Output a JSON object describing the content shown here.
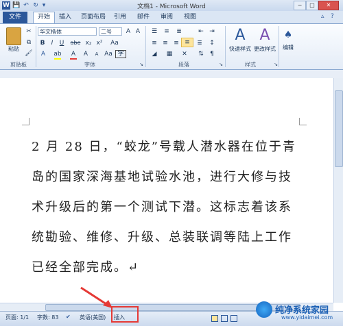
{
  "window": {
    "title": "文档1 - Microsoft Word",
    "controls": [
      "−",
      "□",
      "✕"
    ]
  },
  "quick_access": [
    "W",
    "💾",
    "↶",
    "↻",
    "▾"
  ],
  "ribbon": {
    "tabs": [
      "文件",
      "开始",
      "插入",
      "页面布局",
      "引用",
      "邮件",
      "审阅",
      "视图"
    ],
    "active_tab": "开始",
    "clipboard": {
      "label": "剪贴板",
      "paste": "粘贴"
    },
    "font": {
      "label": "字体",
      "family": "华文楷体",
      "size": "二号",
      "buttons": [
        "B",
        "I",
        "U",
        "abe",
        "x₂",
        "x²",
        "A",
        "A",
        "Aa",
        "A",
        "A"
      ]
    },
    "paragraph": {
      "label": "段落"
    },
    "styles": {
      "label": "样式",
      "quick_styles": "快速样式",
      "change_styles": "更改样式"
    },
    "editing": {
      "label": "编辑"
    }
  },
  "document": {
    "lines": [
      "2 月 28 日，“蛟龙”号载人潜水器在位于青",
      "岛的国家深海基地试验水池，进行大修与技",
      "术升级后的第一个测试下潜。这标志着该系",
      "统勘验、维修、升级、总装联调等陆上工作",
      "已经全部完成。↵"
    ]
  },
  "statusbar": {
    "page": "页面: 1/1",
    "words": "字数: 83",
    "language": "英语(美国)",
    "mode": "插入"
  },
  "watermark": {
    "name": "纯净系统家园",
    "url": "www.yidaimei.com"
  },
  "colors": {
    "accent": "#2b579a",
    "highlight": "#e53935"
  }
}
